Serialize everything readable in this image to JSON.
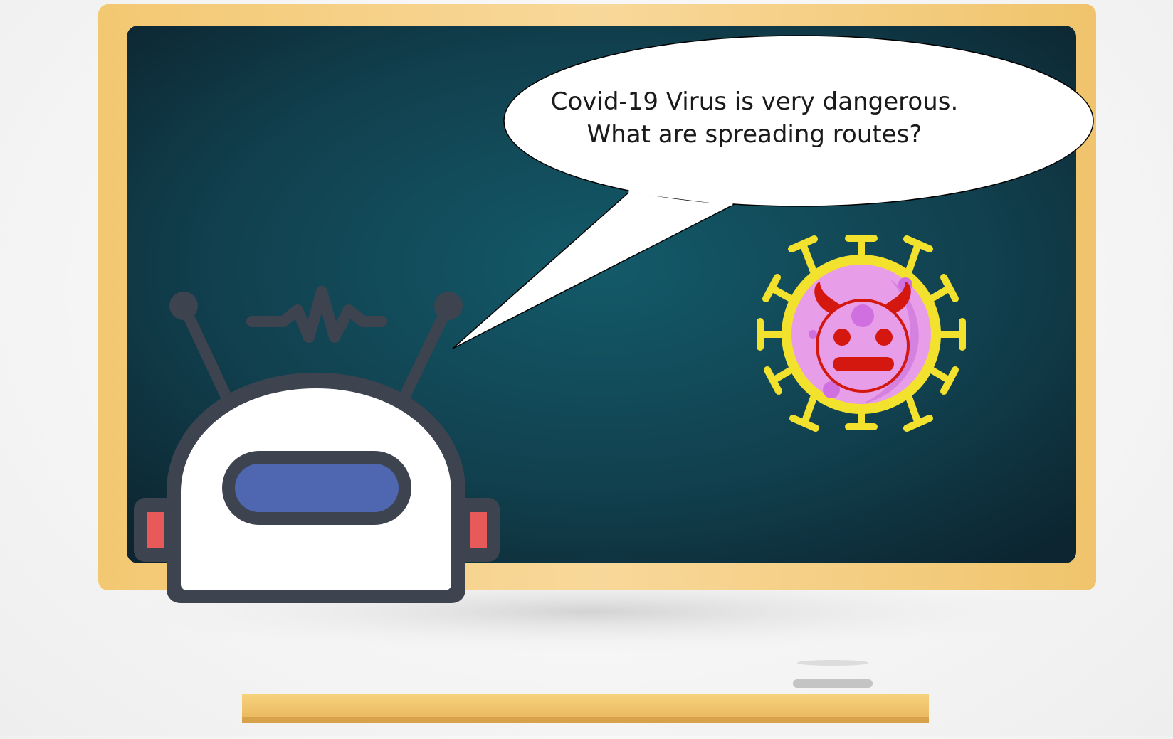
{
  "speech_bubble": {
    "line1": "Covid-19 Virus is very dangerous.",
    "line2": "What are spreading routes?"
  },
  "icons": {
    "robot": "robot-icon",
    "virus": "devil-virus-icon",
    "heartbeat": "heartbeat-icon"
  },
  "colors": {
    "frame_gold": "#f2c46a",
    "board_teal": "#12505e",
    "robot_outline": "#3e4350",
    "robot_visor": "#4e67b0",
    "robot_ear": "#e85a5a",
    "virus_ring": "#f2e22e",
    "virus_body": "#e79de8",
    "virus_face": "#d4170f"
  }
}
